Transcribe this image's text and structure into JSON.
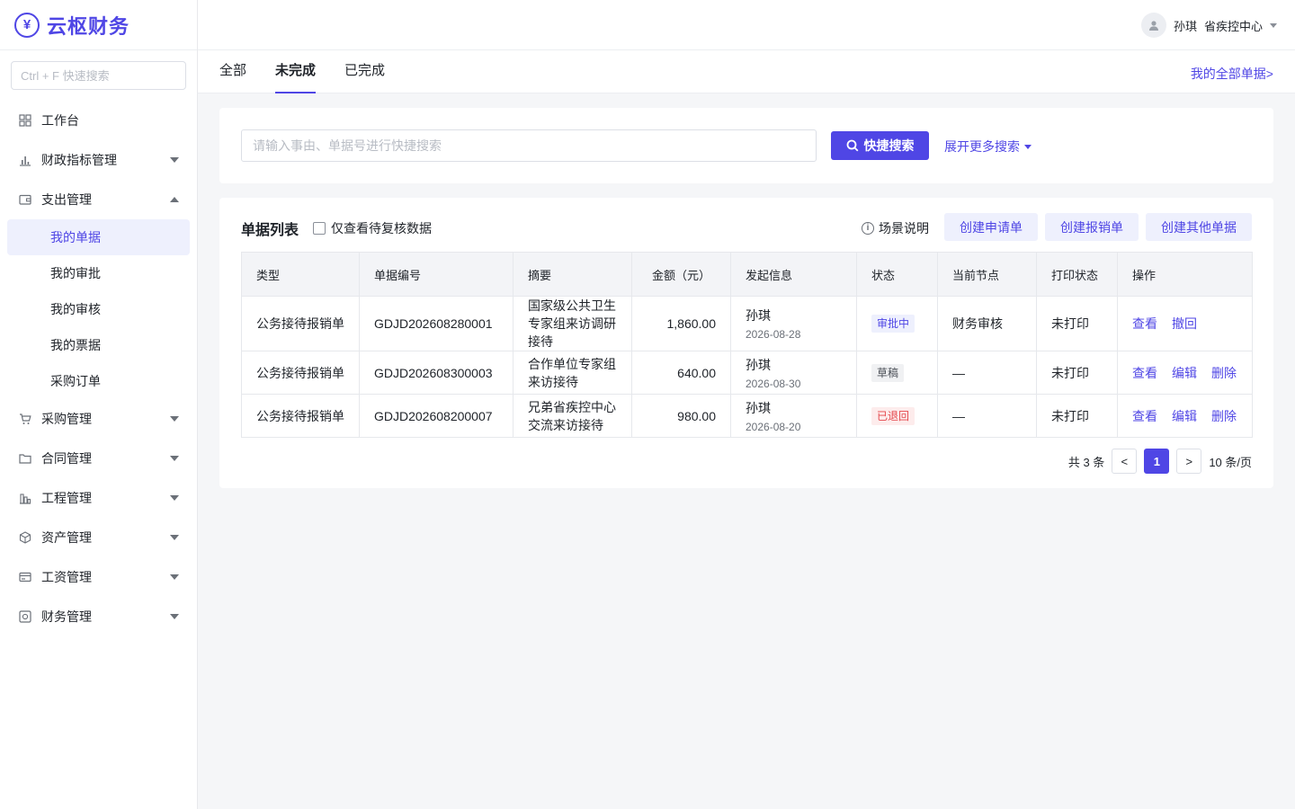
{
  "brand": {
    "name": "云枢财务",
    "logo_glyph": "¥"
  },
  "sidebar": {
    "search_placeholder": "Ctrl + F 快速搜索",
    "items": [
      {
        "label": "工作台",
        "icon": "grid-icon"
      },
      {
        "label": "财政指标管理",
        "icon": "bar-chart-icon"
      },
      {
        "label": "支出管理",
        "icon": "wallet-icon"
      },
      {
        "label": "采购管理",
        "icon": "cart-icon"
      },
      {
        "label": "合同管理",
        "icon": "folder-icon"
      },
      {
        "label": "工程管理",
        "icon": "building-icon"
      },
      {
        "label": "资产管理",
        "icon": "box-icon"
      },
      {
        "label": "工资管理",
        "icon": "card-icon"
      },
      {
        "label": "财务管理",
        "icon": "finance-icon"
      }
    ],
    "sub_items": [
      "我的单据",
      "我的审批",
      "我的审核",
      "我的票据",
      "采购订单"
    ]
  },
  "header": {
    "user_name": "孙琪",
    "org": "省疾控中心"
  },
  "tabs": {
    "all": "全部",
    "incomplete": "未完成",
    "complete": "已完成",
    "all_docs_link": "我的全部单据>"
  },
  "search": {
    "placeholder": "请输入事由、单据号进行快捷搜索",
    "button": "快捷搜索",
    "more": "展开更多搜索"
  },
  "list": {
    "title": "单据列表",
    "filter_label": "仅查看待复核数据",
    "scene": "场景说明",
    "buttons": [
      "创建申请单",
      "创建报销单",
      "创建其他单据"
    ],
    "columns": [
      "类型",
      "单据编号",
      "摘要",
      "金额（元）",
      "发起信息",
      "状态",
      "当前节点",
      "打印状态",
      "操作"
    ],
    "rows": [
      {
        "type": "公务接待报销单",
        "code": "GDJD202608280001",
        "summary": "国家级公共卫生专家组来访调研接待",
        "amount": "1,860.00",
        "initiator": "孙琪",
        "date": "2026-08-28",
        "status": "审批中",
        "node": "财务审核",
        "print": "未打印",
        "ops": [
          "查看",
          "撤回"
        ]
      },
      {
        "type": "公务接待报销单",
        "code": "GDJD202608300003",
        "summary": "合作单位专家组来访接待",
        "amount": "640.00",
        "initiator": "孙琪",
        "date": "2026-08-30",
        "status": "草稿",
        "node": "—",
        "print": "未打印",
        "ops": [
          "查看",
          "编辑",
          "删除"
        ]
      },
      {
        "type": "公务接待报销单",
        "code": "GDJD202608200007",
        "summary": "兄弟省疾控中心交流来访接待",
        "amount": "980.00",
        "initiator": "孙琪",
        "date": "2026-08-20",
        "status": "已退回",
        "node": "—",
        "print": "未打印",
        "ops": [
          "查看",
          "编辑",
          "删除"
        ]
      }
    ]
  },
  "pagination": {
    "total": "共 3 条",
    "prev": "<",
    "current": "1",
    "next": ">",
    "page_size": "10 条/页"
  },
  "colors": {
    "accent": "#4f46e5",
    "status_approving_bg": "#eef0fd",
    "status_draft_bg": "#f0f1f3",
    "status_returned_bg": "#fdecec",
    "status_returned_text": "#e5484d"
  }
}
